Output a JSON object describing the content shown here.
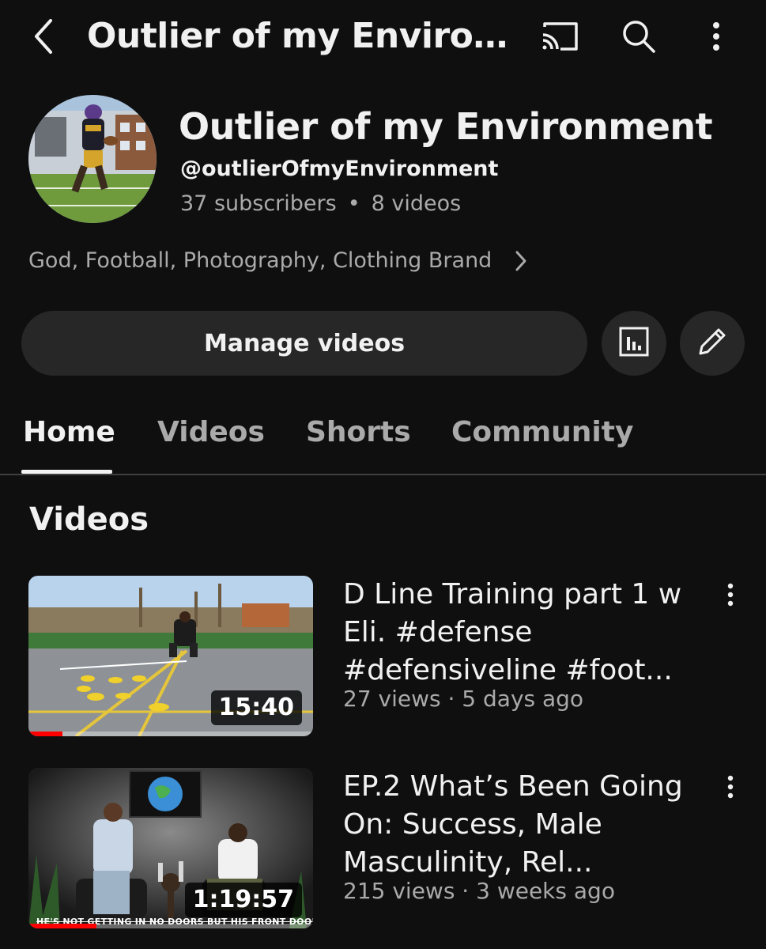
{
  "topbar": {
    "title": "Outlier of my Environ...",
    "icons": [
      "back-arrow-icon",
      "cast-icon",
      "search-icon",
      "more-vertical-icon"
    ]
  },
  "channel": {
    "name": "Outlier of my Environment",
    "handle": "@outlierOfmyEnvironment",
    "subscribers": "37 subscribers",
    "separator": "•",
    "videos_count": "8 videos",
    "description": "God, Football, Photography, Clothing Brand"
  },
  "actions": {
    "manage_label": "Manage videos",
    "icons": [
      "analytics-icon",
      "edit-pencil-icon"
    ]
  },
  "tabs": [
    {
      "label": "Home",
      "active": true
    },
    {
      "label": "Videos",
      "active": false
    },
    {
      "label": "Shorts",
      "active": false
    },
    {
      "label": "Community",
      "active": false
    }
  ],
  "section": {
    "title": "Videos"
  },
  "videos": [
    {
      "title": "D Line Training part 1 w Eli. #defense #defensiveline #foot...",
      "meta": "27 views · 5 days ago",
      "duration": "15:40",
      "watched_fraction": 0.12
    },
    {
      "title": "EP.2 What’s Been Going On: Success, Male Masculinity, Rel...",
      "meta": "215 views · 3 weeks ago",
      "duration": "1:19:57",
      "watched_fraction": 0.24,
      "thumb_caption": "HE'S NOT GETTING IN NO DOORS BUT HIS FRONT DOOR"
    }
  ],
  "colors": {
    "background": "#0f0f0f",
    "surface": "#272727",
    "text_primary": "#f1f1f1",
    "text_secondary": "#aaaaaa",
    "progress": "#ff0000"
  }
}
